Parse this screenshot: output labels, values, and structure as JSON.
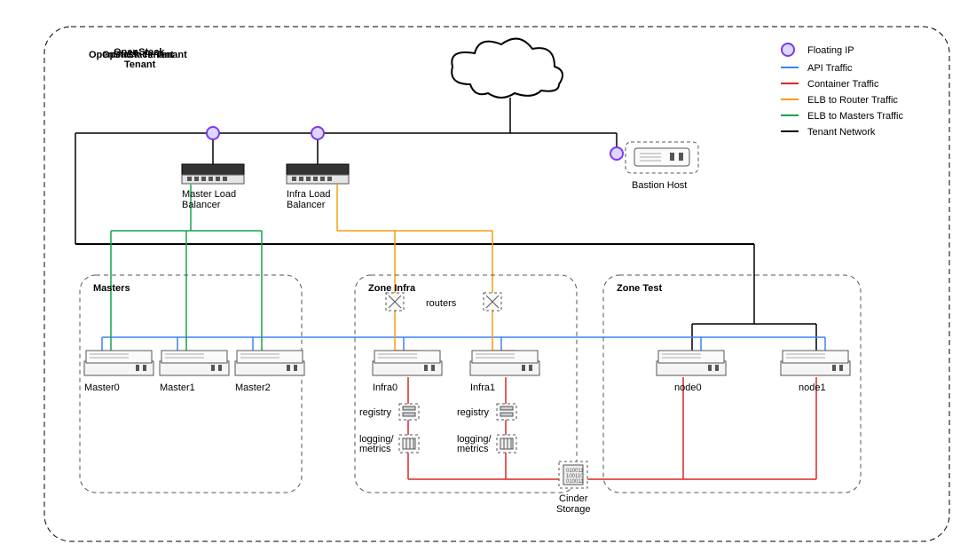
{
  "title": "OpenStack Tenant",
  "legend": {
    "floating_ip": "Floating IP",
    "api_traffic": "API Traffic",
    "container_traffic": "Container Traffic",
    "elb_router": "ELB to Router Traffic",
    "elb_masters": "ELB to Masters Traffic",
    "tenant_network": "Tenant Network"
  },
  "devices": {
    "master_lb": "Master Load Balancer",
    "infra_lb": "Infra Load Balancer",
    "bastion": "Bastion Host",
    "master0": "Master0",
    "master1": "Master1",
    "master2": "Master2",
    "infra0": "Infra0",
    "infra1": "Infra1",
    "node0": "node0",
    "node1": "node1",
    "routers": "routers",
    "registry": "registry",
    "logging": "logging/ metrics",
    "cinder": "Cinder Storage"
  },
  "zones": {
    "masters": "Masters",
    "infra": "Zone Infra",
    "test": "Zone Test"
  },
  "colors": {
    "api": "#3b82f6",
    "container": "#dc2626",
    "elb_router": "#f59e0b",
    "elb_masters": "#16a34a",
    "tenant": "#000000",
    "floating_fill": "#ddd6fe",
    "floating_stroke": "#7c3aed"
  }
}
